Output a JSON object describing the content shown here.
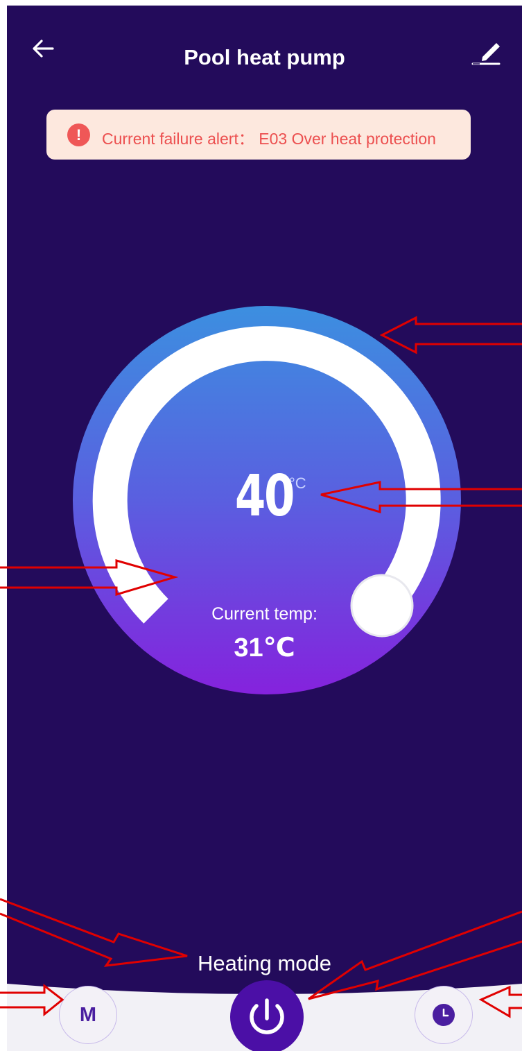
{
  "header": {
    "title": "Pool heat pump"
  },
  "alert": {
    "text": "Current failure alert： E03 Over heat protection"
  },
  "dial": {
    "setpoint": "40",
    "setpoint_unit": "°C",
    "current_label": "Current temp:",
    "current_value": "31℃"
  },
  "mode": {
    "label": "Heating mode"
  },
  "bottom_bar": {
    "mode_button_label": "M"
  },
  "colors": {
    "background": "#230b5b",
    "alert_background": "#fde8de",
    "alert_text": "#ec4f4f",
    "dial_top": "#3c8fe0",
    "dial_bottom": "#8522dd",
    "power_button": "#4b0fa6",
    "annotation": "#e00000"
  }
}
